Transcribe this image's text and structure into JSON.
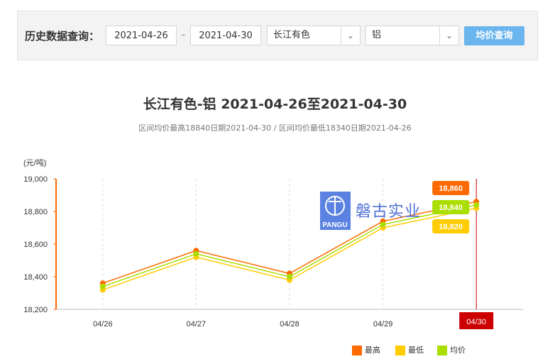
{
  "query": {
    "label": "历史数据查询：",
    "start_date": "2021-04-26",
    "separator": "–",
    "end_date": "2021-04-30",
    "market": "长江有色",
    "metal": "铝",
    "button": "均价查询"
  },
  "watermark": {
    "logo_text": "PANGU",
    "text": "磐古实业"
  },
  "chart_data": {
    "type": "line",
    "title": "长江有色-铝 2021-04-26至2021-04-30",
    "subtitle": "区间均价最高18840日期2021-04-30 / 区间均价最低18340日期2021-04-26",
    "ylabel": "(元/吨)",
    "ylim": [
      18200,
      19000
    ],
    "yticks": [
      "18,200",
      "18,400",
      "18,600",
      "18,800",
      "19,000"
    ],
    "categories": [
      "04/26",
      "04/27",
      "04/28",
      "04/29",
      "04/30"
    ],
    "series": [
      {
        "name": "最高",
        "color": "#ff6a00",
        "values": [
          18360,
          18560,
          18420,
          18740,
          18860
        ]
      },
      {
        "name": "最低",
        "color": "#ffcc00",
        "values": [
          18320,
          18520,
          18380,
          18700,
          18820
        ]
      },
      {
        "name": "均价",
        "color": "#aadd00",
        "values": [
          18340,
          18540,
          18400,
          18720,
          18840
        ]
      }
    ],
    "tooltip": {
      "category": "04/30",
      "labels": [
        "18,860",
        "18,840",
        "18,820"
      ]
    },
    "legend": "bottom-right",
    "grid": true
  },
  "colors": {
    "axis": "#ff6a00",
    "crosshair": "#cc0000",
    "button": "#6ab5ee"
  }
}
